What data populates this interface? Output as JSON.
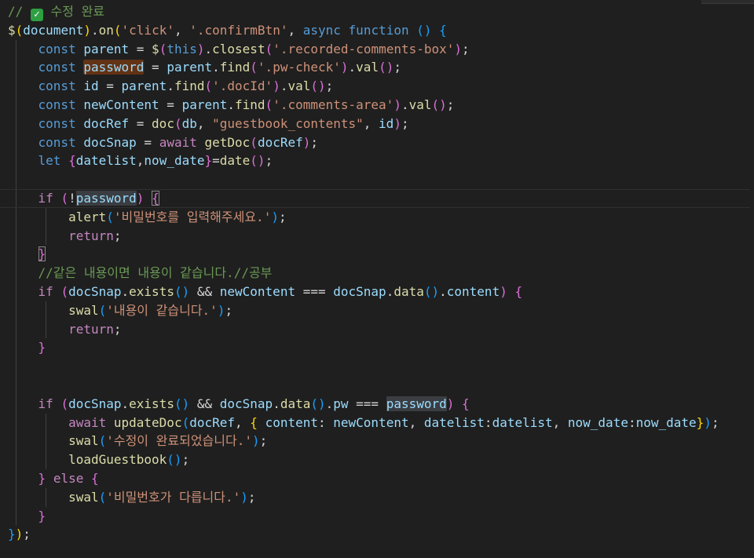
{
  "editor": {
    "comment_heading": {
      "prefix": "// ",
      "icon": "check-mark-icon",
      "text": " 수정 완료"
    },
    "lines": [
      {
        "segments": [
          [
            "$",
            "f"
          ],
          [
            "(",
            "p"
          ],
          [
            "document",
            "v"
          ],
          [
            ")",
            "p"
          ],
          [
            ".",
            "t"
          ],
          [
            "on",
            "f"
          ],
          [
            "(",
            "p"
          ],
          [
            "'click'",
            "s"
          ],
          [
            ", ",
            "t"
          ],
          [
            "'.confirmBtn'",
            "s"
          ],
          [
            ", ",
            "t"
          ],
          [
            "async",
            "k"
          ],
          [
            " ",
            "t"
          ],
          [
            "function",
            "k"
          ],
          [
            " ",
            "t"
          ],
          [
            "()",
            "p3"
          ],
          [
            " ",
            "t"
          ],
          [
            "{",
            "p3"
          ]
        ],
        "indent": 0
      },
      {
        "segments": [
          [
            "const",
            "k"
          ],
          [
            " ",
            "t"
          ],
          [
            "parent",
            "v"
          ],
          [
            " = ",
            "t"
          ],
          [
            "$",
            "f"
          ],
          [
            "(",
            "p2"
          ],
          [
            "this",
            "k"
          ],
          [
            ")",
            "p2"
          ],
          [
            ".",
            "t"
          ],
          [
            "closest",
            "f"
          ],
          [
            "(",
            "p2"
          ],
          [
            "'.recorded-comments-box'",
            "s"
          ],
          [
            ")",
            "p2"
          ],
          [
            ";",
            "t"
          ]
        ],
        "indent": 1
      },
      {
        "segments": [
          [
            "const",
            "k"
          ],
          [
            " ",
            "t"
          ],
          [
            "password",
            "v hl"
          ],
          [
            " = ",
            "t"
          ],
          [
            "parent",
            "v"
          ],
          [
            ".",
            "t"
          ],
          [
            "find",
            "f"
          ],
          [
            "(",
            "p2"
          ],
          [
            "'.pw-check'",
            "s"
          ],
          [
            ")",
            "p2"
          ],
          [
            ".",
            "t"
          ],
          [
            "val",
            "f"
          ],
          [
            "()",
            "p2"
          ],
          [
            ";",
            "t"
          ]
        ],
        "indent": 1
      },
      {
        "segments": [
          [
            "const",
            "k"
          ],
          [
            " ",
            "t"
          ],
          [
            "id",
            "v"
          ],
          [
            " = ",
            "t"
          ],
          [
            "parent",
            "v"
          ],
          [
            ".",
            "t"
          ],
          [
            "find",
            "f"
          ],
          [
            "(",
            "p2"
          ],
          [
            "'.docId'",
            "s"
          ],
          [
            ")",
            "p2"
          ],
          [
            ".",
            "t"
          ],
          [
            "val",
            "f"
          ],
          [
            "()",
            "p2"
          ],
          [
            ";",
            "t"
          ]
        ],
        "indent": 1
      },
      {
        "segments": [
          [
            "const",
            "k"
          ],
          [
            " ",
            "t"
          ],
          [
            "newContent",
            "v"
          ],
          [
            " = ",
            "t"
          ],
          [
            "parent",
            "v"
          ],
          [
            ".",
            "t"
          ],
          [
            "find",
            "f"
          ],
          [
            "(",
            "p2"
          ],
          [
            "'.comments-area'",
            "s"
          ],
          [
            ")",
            "p2"
          ],
          [
            ".",
            "t"
          ],
          [
            "val",
            "f"
          ],
          [
            "()",
            "p2"
          ],
          [
            ";",
            "t"
          ]
        ],
        "indent": 1
      },
      {
        "segments": [
          [
            "const",
            "k"
          ],
          [
            " ",
            "t"
          ],
          [
            "docRef",
            "v"
          ],
          [
            " = ",
            "t"
          ],
          [
            "doc",
            "f"
          ],
          [
            "(",
            "p2"
          ],
          [
            "db",
            "v"
          ],
          [
            ", ",
            "t"
          ],
          [
            "\"guestbook_contents\"",
            "s"
          ],
          [
            ", ",
            "t"
          ],
          [
            "id",
            "v"
          ],
          [
            ")",
            "p2"
          ],
          [
            ";",
            "t"
          ]
        ],
        "indent": 1
      },
      {
        "segments": [
          [
            "const",
            "k"
          ],
          [
            " ",
            "t"
          ],
          [
            "docSnap",
            "v"
          ],
          [
            " = ",
            "t"
          ],
          [
            "await",
            "c"
          ],
          [
            " ",
            "t"
          ],
          [
            "getDoc",
            "f"
          ],
          [
            "(",
            "p2"
          ],
          [
            "docRef",
            "v"
          ],
          [
            ")",
            "p2"
          ],
          [
            ";",
            "t"
          ]
        ],
        "indent": 1
      },
      {
        "segments": [
          [
            "let",
            "k"
          ],
          [
            " ",
            "t"
          ],
          [
            "{",
            "p2"
          ],
          [
            "datelist",
            "v"
          ],
          [
            ",",
            "t"
          ],
          [
            "now_date",
            "v"
          ],
          [
            "}",
            "p2"
          ],
          [
            "=",
            "t"
          ],
          [
            "date",
            "f"
          ],
          [
            "()",
            "p2"
          ],
          [
            ";",
            "t"
          ]
        ],
        "indent": 1
      },
      {
        "segments": [],
        "indent": 1
      },
      {
        "segments": [
          [
            "if",
            "c"
          ],
          [
            " ",
            "t"
          ],
          [
            "(",
            "p2"
          ],
          [
            "!",
            "t"
          ],
          [
            "password",
            "v hl2"
          ],
          [
            ")",
            "p2"
          ],
          [
            " ",
            "t"
          ],
          [
            "{",
            "p2 bm"
          ]
        ],
        "indent": 1,
        "active": true
      },
      {
        "segments": [
          [
            "alert",
            "f"
          ],
          [
            "(",
            "p3"
          ],
          [
            "'비밀번호를 입력해주세요.'",
            "s"
          ],
          [
            ")",
            "p3"
          ],
          [
            ";",
            "t"
          ]
        ],
        "indent": 2
      },
      {
        "segments": [
          [
            "return",
            "c"
          ],
          [
            ";",
            "t"
          ]
        ],
        "indent": 2
      },
      {
        "segments": [
          [
            "}",
            "p2 bm"
          ]
        ],
        "indent": 1
      },
      {
        "segments": [
          [
            "//같은 내용이면 내용이 같습니다.//공부",
            "cm"
          ]
        ],
        "indent": 1
      },
      {
        "segments": [
          [
            "if",
            "c"
          ],
          [
            " ",
            "t"
          ],
          [
            "(",
            "p2"
          ],
          [
            "docSnap",
            "v"
          ],
          [
            ".",
            "t"
          ],
          [
            "exists",
            "f"
          ],
          [
            "()",
            "p3"
          ],
          [
            " && ",
            "t"
          ],
          [
            "newContent",
            "v"
          ],
          [
            " === ",
            "t"
          ],
          [
            "docSnap",
            "v"
          ],
          [
            ".",
            "t"
          ],
          [
            "data",
            "f"
          ],
          [
            "()",
            "p3"
          ],
          [
            ".",
            "t"
          ],
          [
            "content",
            "v"
          ],
          [
            ")",
            "p2"
          ],
          [
            " ",
            "t"
          ],
          [
            "{",
            "p2"
          ]
        ],
        "indent": 1
      },
      {
        "segments": [
          [
            "swal",
            "f"
          ],
          [
            "(",
            "p3"
          ],
          [
            "'내용이 같습니다.'",
            "s"
          ],
          [
            ")",
            "p3"
          ],
          [
            ";",
            "t"
          ]
        ],
        "indent": 2
      },
      {
        "segments": [
          [
            "return",
            "c"
          ],
          [
            ";",
            "t"
          ]
        ],
        "indent": 2
      },
      {
        "segments": [
          [
            "}",
            "p2"
          ]
        ],
        "indent": 1
      },
      {
        "segments": [],
        "indent": 1
      },
      {
        "segments": [],
        "indent": 1
      },
      {
        "segments": [
          [
            "if",
            "c"
          ],
          [
            " ",
            "t"
          ],
          [
            "(",
            "p2"
          ],
          [
            "docSnap",
            "v"
          ],
          [
            ".",
            "t"
          ],
          [
            "exists",
            "f"
          ],
          [
            "()",
            "p3"
          ],
          [
            " && ",
            "t"
          ],
          [
            "docSnap",
            "v"
          ],
          [
            ".",
            "t"
          ],
          [
            "data",
            "f"
          ],
          [
            "()",
            "p3"
          ],
          [
            ".",
            "t"
          ],
          [
            "pw",
            "v"
          ],
          [
            " === ",
            "t"
          ],
          [
            "password",
            "v hl2"
          ],
          [
            ")",
            "p2"
          ],
          [
            " ",
            "t"
          ],
          [
            "{",
            "p2"
          ]
        ],
        "indent": 1
      },
      {
        "segments": [
          [
            "await",
            "c"
          ],
          [
            " ",
            "t"
          ],
          [
            "updateDoc",
            "f"
          ],
          [
            "(",
            "p3"
          ],
          [
            "docRef",
            "v"
          ],
          [
            ", ",
            "t"
          ],
          [
            "{",
            "p"
          ],
          [
            " ",
            "t"
          ],
          [
            "content",
            "v"
          ],
          [
            ": ",
            "t"
          ],
          [
            "newContent",
            "v"
          ],
          [
            ", ",
            "t"
          ],
          [
            "datelist",
            "v"
          ],
          [
            ":",
            "t"
          ],
          [
            "datelist",
            "v"
          ],
          [
            ", ",
            "t"
          ],
          [
            "now_date",
            "v"
          ],
          [
            ":",
            "t"
          ],
          [
            "now_date",
            "v"
          ],
          [
            "}",
            "p"
          ],
          [
            ")",
            "p3"
          ],
          [
            ";",
            "t"
          ]
        ],
        "indent": 2
      },
      {
        "segments": [
          [
            "swal",
            "f"
          ],
          [
            "(",
            "p3"
          ],
          [
            "'수정이 완료되었습니다.'",
            "s"
          ],
          [
            ")",
            "p3"
          ],
          [
            ";",
            "t"
          ]
        ],
        "indent": 2
      },
      {
        "segments": [
          [
            "loadGuestbook",
            "f"
          ],
          [
            "()",
            "p3"
          ],
          [
            ";",
            "t"
          ]
        ],
        "indent": 2
      },
      {
        "segments": [
          [
            "}",
            "p2"
          ],
          [
            " ",
            "t"
          ],
          [
            "else",
            "c"
          ],
          [
            " ",
            "t"
          ],
          [
            "{",
            "p2"
          ]
        ],
        "indent": 1
      },
      {
        "segments": [
          [
            "swal",
            "f"
          ],
          [
            "(",
            "p3"
          ],
          [
            "'비밀번호가 다릅니다.'",
            "s"
          ],
          [
            ")",
            "p3"
          ],
          [
            ";",
            "t"
          ]
        ],
        "indent": 2
      },
      {
        "segments": [
          [
            "}",
            "p2"
          ]
        ],
        "indent": 1
      },
      {
        "segments": [
          [
            "}",
            "p3"
          ],
          [
            ")",
            "p"
          ],
          [
            ";",
            "t"
          ]
        ],
        "indent": 0
      }
    ]
  }
}
